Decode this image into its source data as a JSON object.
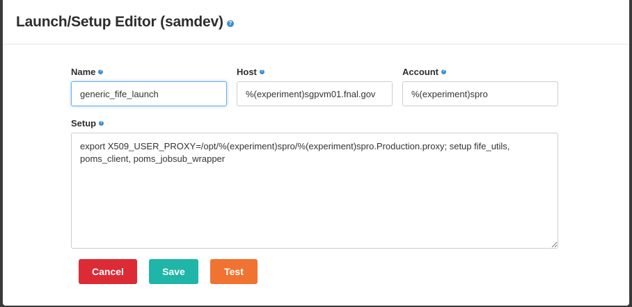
{
  "modal": {
    "title": "Launch/Setup Editor (samdev)",
    "help_icon": "question-circle-icon"
  },
  "fields": {
    "name": {
      "label": "Name",
      "value": "generic_fife_launch"
    },
    "host": {
      "label": "Host",
      "value": "%(experiment)sgpvm01.fnal.gov"
    },
    "account": {
      "label": "Account",
      "value": "%(experiment)spro"
    },
    "setup": {
      "label": "Setup",
      "value": "export X509_USER_PROXY=/opt/%(experiment)spro/%(experiment)spro.Production.proxy; setup fife_utils, poms_client, poms_jobsub_wrapper"
    }
  },
  "buttons": {
    "cancel": "Cancel",
    "save": "Save",
    "test": "Test"
  },
  "colors": {
    "cancel": "#dc2b35",
    "save": "#1fb5a8",
    "test": "#f07332",
    "help": "#3d8ccc"
  }
}
